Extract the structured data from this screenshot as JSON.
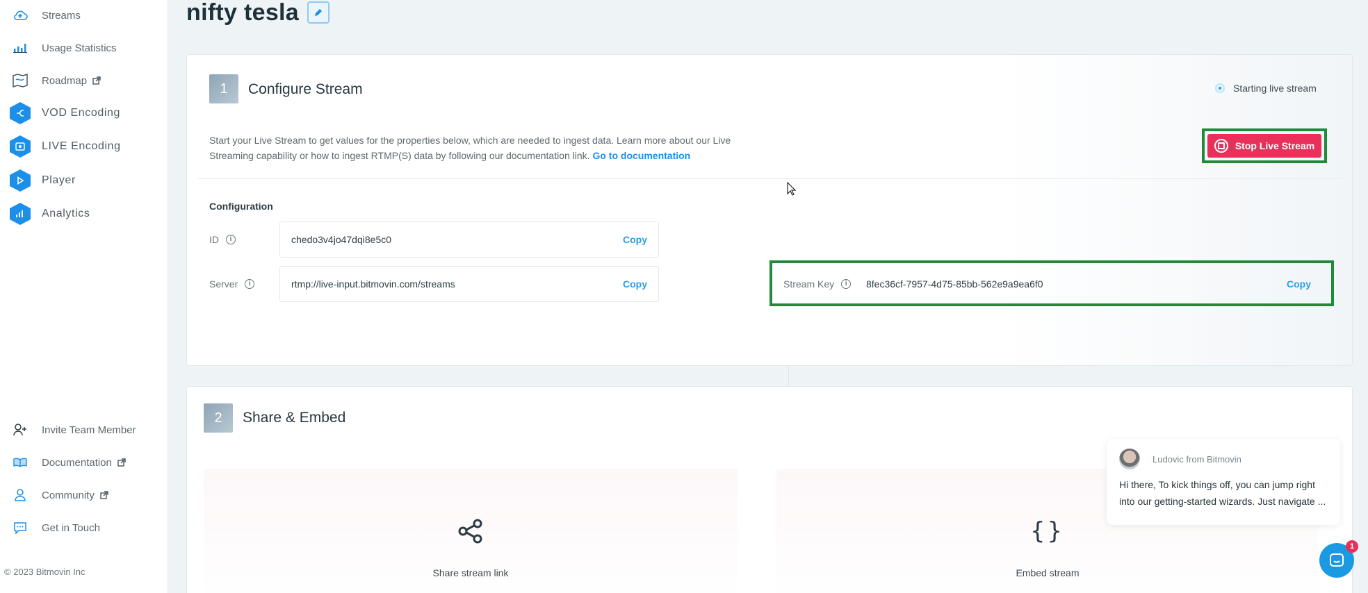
{
  "sidebar": {
    "items": [
      {
        "label": "Streams",
        "icon": "cloud-upload-icon"
      },
      {
        "label": "Usage Statistics",
        "icon": "bar-chart-icon"
      },
      {
        "label": "Roadmap",
        "icon": "map-icon",
        "external": true
      },
      {
        "label": "VOD Encoding",
        "icon": "vod-encoding-icon"
      },
      {
        "label": "LIVE Encoding",
        "icon": "live-encoding-icon"
      },
      {
        "label": "Player",
        "icon": "player-icon"
      },
      {
        "label": "Analytics",
        "icon": "analytics-icon"
      }
    ],
    "bottom_items": [
      {
        "label": "Invite Team Member",
        "icon": "add-user-icon"
      },
      {
        "label": "Documentation",
        "icon": "book-icon",
        "external": true
      },
      {
        "label": "Community",
        "icon": "user-icon",
        "external": true
      },
      {
        "label": "Get in Touch",
        "icon": "chat-icon"
      }
    ],
    "copyright": "© 2023 Bitmovin Inc"
  },
  "page": {
    "title": "nifty tesla"
  },
  "configure": {
    "step": "1",
    "title": "Configure Stream",
    "status": "Starting live stream",
    "description": "Start your Live Stream to get values for the properties below, which are needed to ingest data. Learn more about our Live Streaming capability or how to ingest RTMP(S) data by following our documentation link.",
    "doc_link": "Go to documentation",
    "stop_button": "Stop Live Stream",
    "config_heading": "Configuration",
    "fields": {
      "id": {
        "label": "ID",
        "value": "chedo3v4jo47dqi8e5c0",
        "copy": "Copy"
      },
      "server": {
        "label": "Server",
        "value": "rtmp://live-input.bitmovin.com/streams",
        "copy": "Copy"
      },
      "stream_key": {
        "label": "Stream Key",
        "value": "8fec36cf-7957-4d75-85bb-562e9a9ea6f0",
        "copy": "Copy"
      }
    }
  },
  "share": {
    "step": "2",
    "title": "Share & Embed",
    "tiles": [
      {
        "label": "Share stream link",
        "icon": "share-icon"
      },
      {
        "label": "Embed stream",
        "icon": "curly-braces-icon",
        "glyph": "{}"
      }
    ]
  },
  "chat": {
    "from": "Ludovic from Bitmovin",
    "message": "Hi there, To kick things off, you can jump right into our getting-started wizards. Just navigate ...",
    "badge": "1"
  },
  "colors": {
    "accent": "#1c8fe8",
    "danger": "#e8305a",
    "highlight": "#1f8a3a"
  }
}
